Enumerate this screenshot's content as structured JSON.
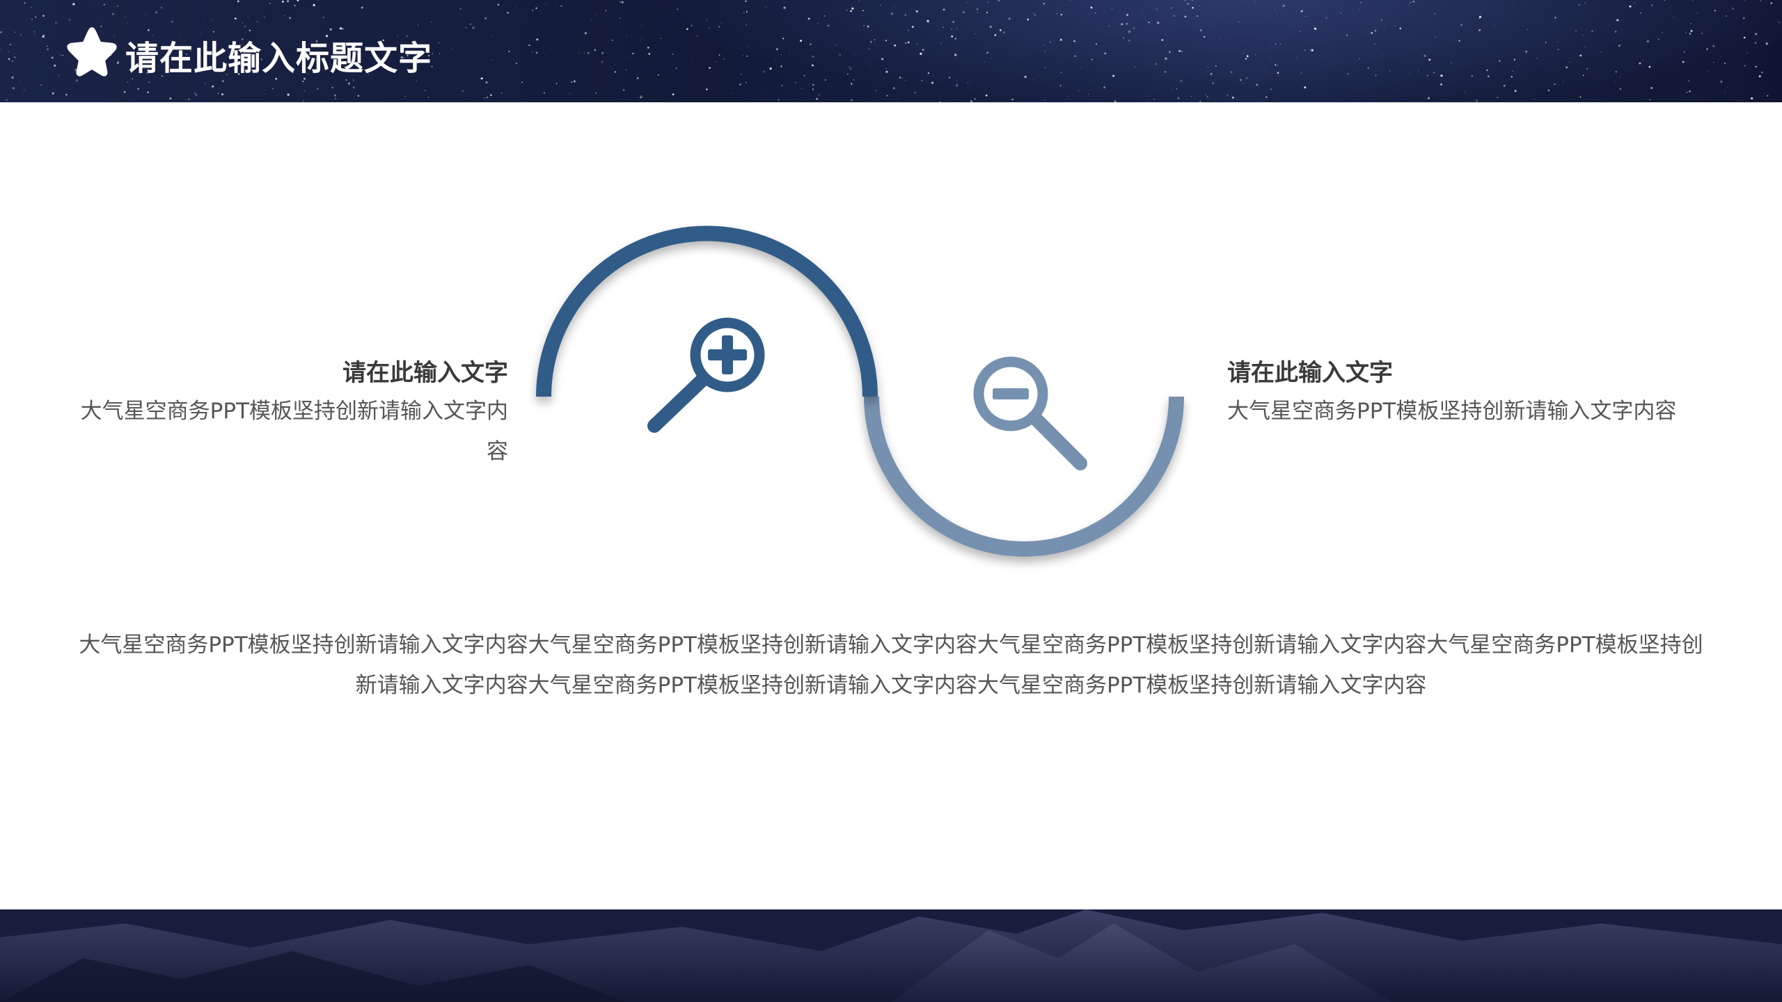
{
  "header": {
    "title": "请在此输入标题文字",
    "icon": "star-icon"
  },
  "left_block": {
    "heading": "请在此输入文字",
    "text": "大气星空商务PPT模板坚持创新请输入文字内容",
    "icon": "zoom-in-icon"
  },
  "right_block": {
    "heading": "请在此输入文字",
    "text": "大气星空商务PPT模板坚持创新请输入文字内容",
    "icon": "zoom-out-icon"
  },
  "body": {
    "paragraph": "大气星空商务PPT模板坚持创新请输入文字内容大气星空商务PPT模板坚持创新请输入文字内容大气星空商务PPT模板坚持创新请输入文字内容大气星空商务PPT模板坚持创新请输入文字内容大气星空商务PPT模板坚持创新请输入文字内容大气星空商务PPT模板坚持创新请输入文字内容"
  },
  "colors": {
    "dark_blue": "#325c88",
    "light_blue": "#7691af",
    "header_bg": "#161d3d",
    "text": "#555555",
    "heading": "#3a3a3a"
  }
}
